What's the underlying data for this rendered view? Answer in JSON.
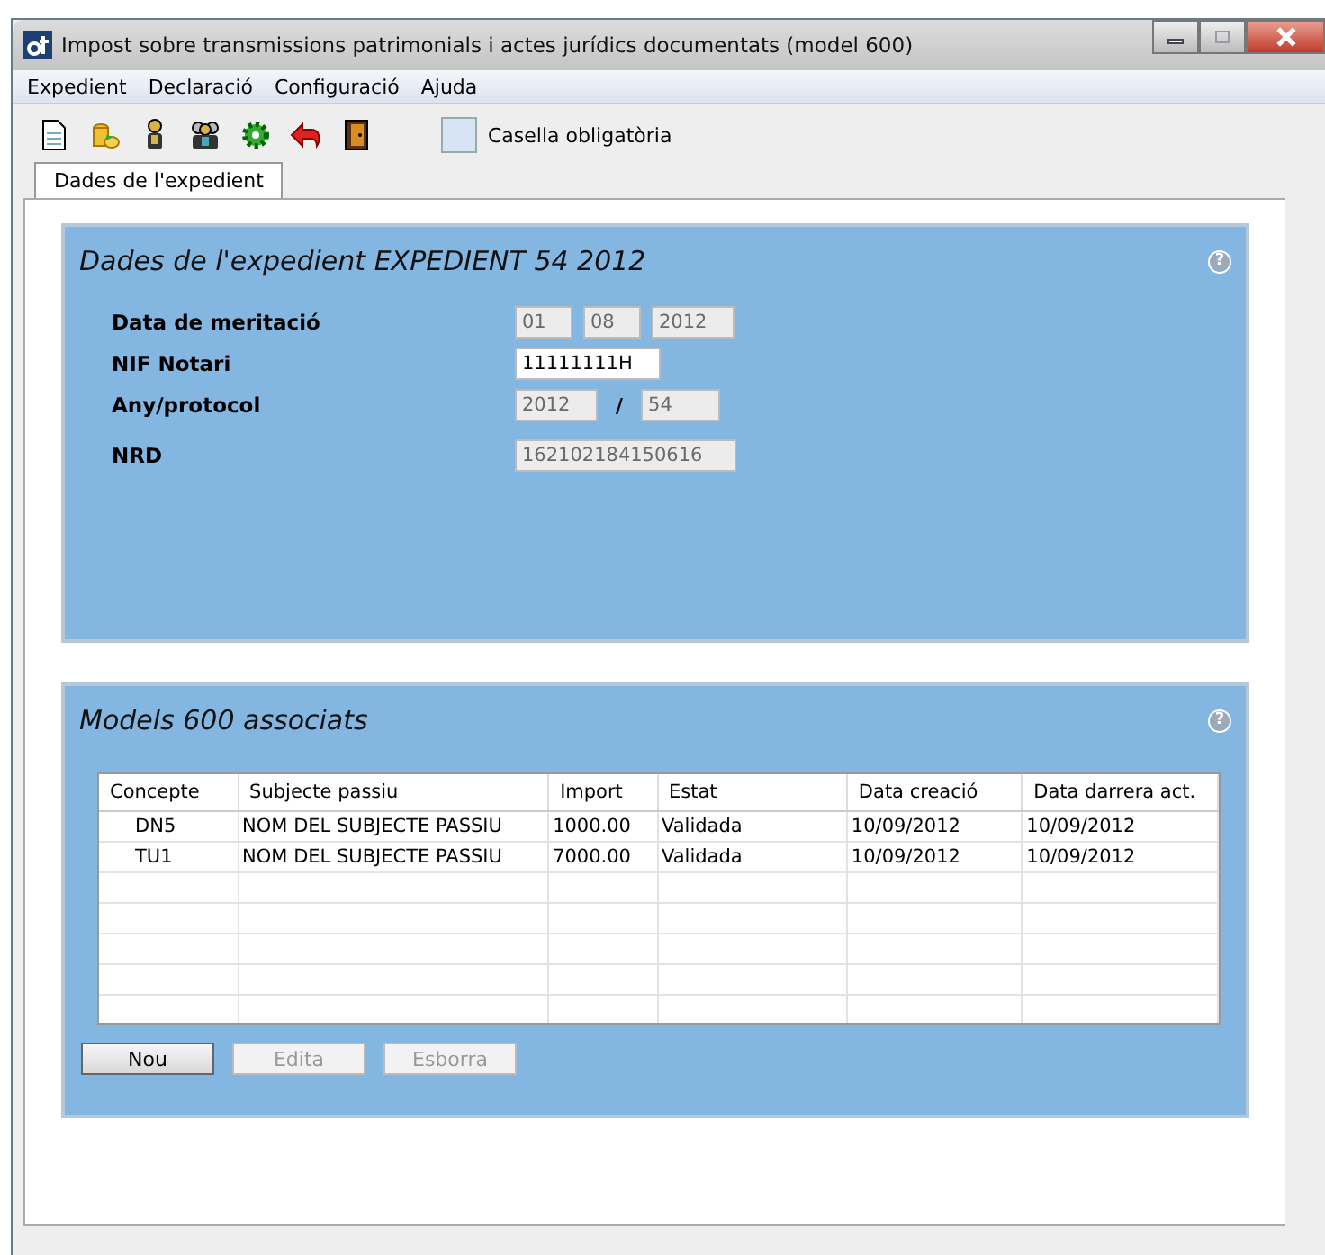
{
  "window": {
    "title": "Impost sobre transmissions patrimonials i actes jurídics documentats (model 600)"
  },
  "menu": [
    "Expedient",
    "Declaració",
    "Configuració",
    "Ajuda"
  ],
  "toolbar": {
    "legend": "Casella obligatòria"
  },
  "tabs": [
    {
      "label": "Dades de l'expedient",
      "selected": true
    }
  ],
  "expedient_panel": {
    "title": "Dades de l'expedient EXPEDIENT 54 2012",
    "help": "?",
    "fields": [
      {
        "label": "Data de meritació",
        "parts": [
          {
            "value": "01",
            "disabled": true
          },
          {
            "value": "08",
            "disabled": true
          },
          {
            "value": "2012",
            "disabled": true
          }
        ]
      },
      {
        "label": "NIF Notari",
        "parts": [
          {
            "value": "11111111H",
            "disabled": false
          }
        ]
      },
      {
        "label": "Any/protocol",
        "separator": "/",
        "parts": [
          {
            "value": "2012",
            "disabled": true
          },
          {
            "value": "54",
            "disabled": true
          }
        ]
      },
      {
        "label": "NRD",
        "parts": [
          {
            "value": "162102184150616",
            "disabled": true
          }
        ]
      }
    ]
  },
  "models_panel": {
    "title": "Models 600 associats",
    "help": "?",
    "table": {
      "columns": [
        "Concepte",
        "Subjecte passiu",
        "Import",
        "Estat",
        "Data creació",
        "Data darrera act."
      ],
      "rows": [
        [
          "DN5",
          "NOM DEL SUBJECTE PASSIU",
          "1000.00",
          "Validada",
          "10/09/2012",
          "10/09/2012"
        ],
        [
          "TU1",
          "NOM DEL SUBJECTE PASSIU",
          "7000.00",
          "Validada",
          "10/09/2012",
          "10/09/2012"
        ]
      ]
    },
    "buttons": [
      {
        "label": "Nou",
        "disabled": false
      },
      {
        "label": "Edita",
        "disabled": true
      },
      {
        "label": "Esborra",
        "disabled": true
      }
    ]
  }
}
